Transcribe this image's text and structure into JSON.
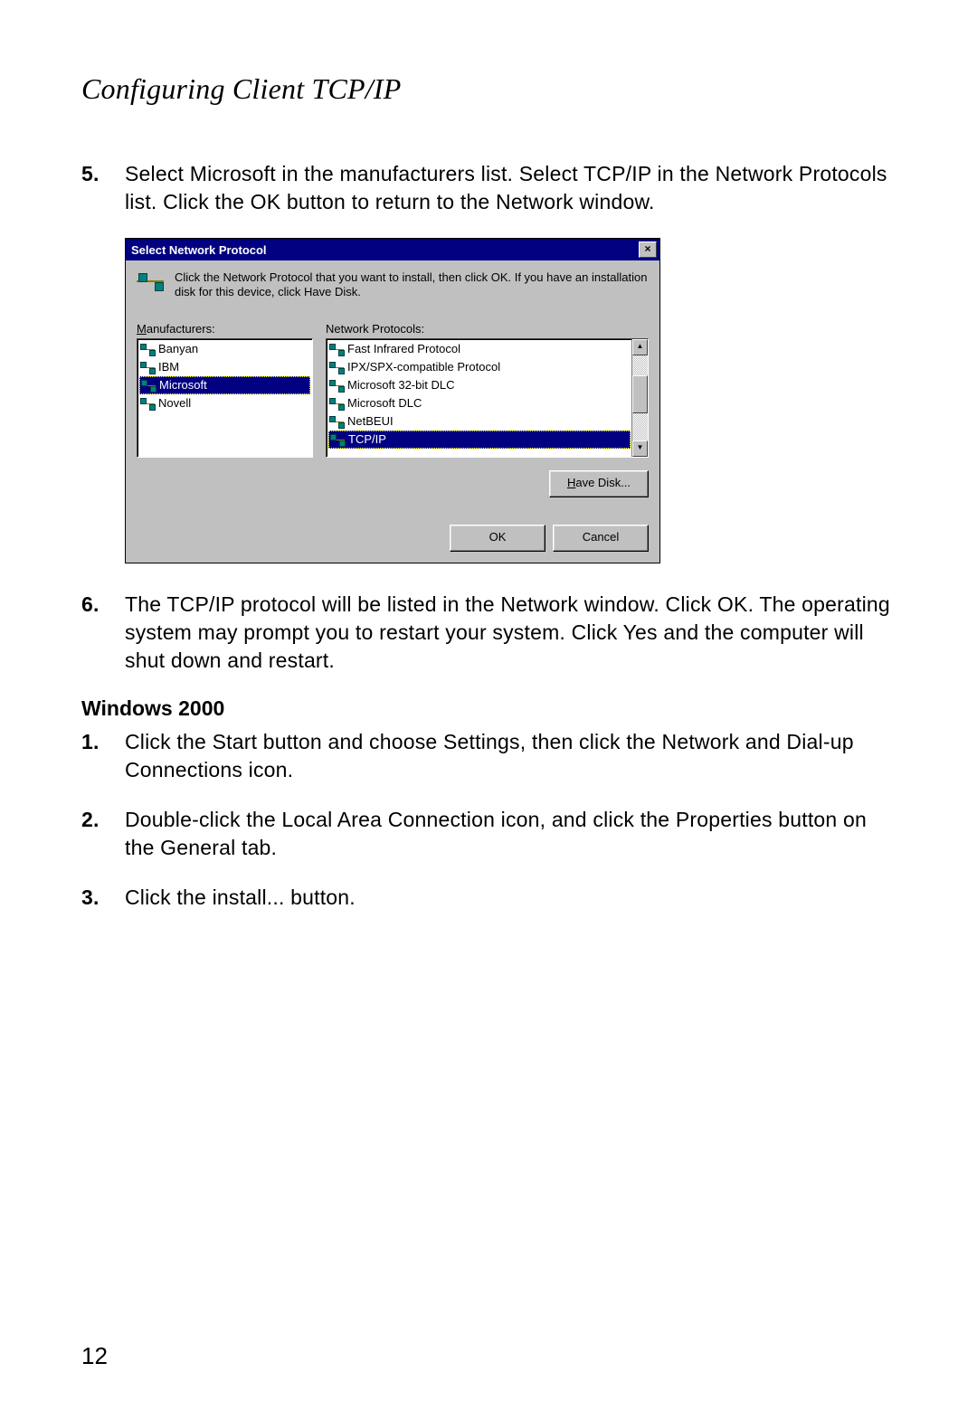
{
  "header_title": "Configuring Client TCP/IP",
  "page_number": "12",
  "steps_top": [
    {
      "num": "5.",
      "text": "Select Microsoft in the manufacturers list. Select TCP/IP in the Network Protocols list. Click the OK button to return to the Network window."
    }
  ],
  "steps_after_dialog": [
    {
      "num": "6.",
      "text": "The TCP/IP protocol will be listed in the Network window. Click OK. The operating system may prompt you to restart your system. Click Yes and the computer will shut down and restart."
    }
  ],
  "subheading": "Windows 2000",
  "steps_win2000": [
    {
      "num": "1.",
      "text": "Click the Start button and choose Settings, then click the Network and Dial-up Connections icon."
    },
    {
      "num": "2.",
      "text": "Double-click the Local Area Connection icon, and click the Properties button on the General tab."
    },
    {
      "num": "3.",
      "text": "Click the install... button."
    }
  ],
  "dialog": {
    "title": "Select Network Protocol",
    "close_glyph": "×",
    "instruction": "Click the Network Protocol that you want to install, then click OK. If you have an installation disk for this device, click Have Disk.",
    "manufacturers_label_pre": "M",
    "manufacturers_label_rest": "anufacturers:",
    "protocols_label": "Network Protocols:",
    "manufacturers": [
      {
        "name": "Banyan",
        "selected": false
      },
      {
        "name": "IBM",
        "selected": false
      },
      {
        "name": "Microsoft",
        "selected": true
      },
      {
        "name": "Novell",
        "selected": false
      }
    ],
    "protocols": [
      {
        "name": "Fast Infrared Protocol",
        "selected": false
      },
      {
        "name": "IPX/SPX-compatible Protocol",
        "selected": false
      },
      {
        "name": "Microsoft 32-bit DLC",
        "selected": false
      },
      {
        "name": "Microsoft DLC",
        "selected": false
      },
      {
        "name": "NetBEUI",
        "selected": false
      },
      {
        "name": "TCP/IP",
        "selected": true
      }
    ],
    "scroll_up": "▲",
    "scroll_down": "▼",
    "have_disk_pre": "H",
    "have_disk_rest": "ave Disk...",
    "ok": "OK",
    "cancel": "Cancel"
  }
}
